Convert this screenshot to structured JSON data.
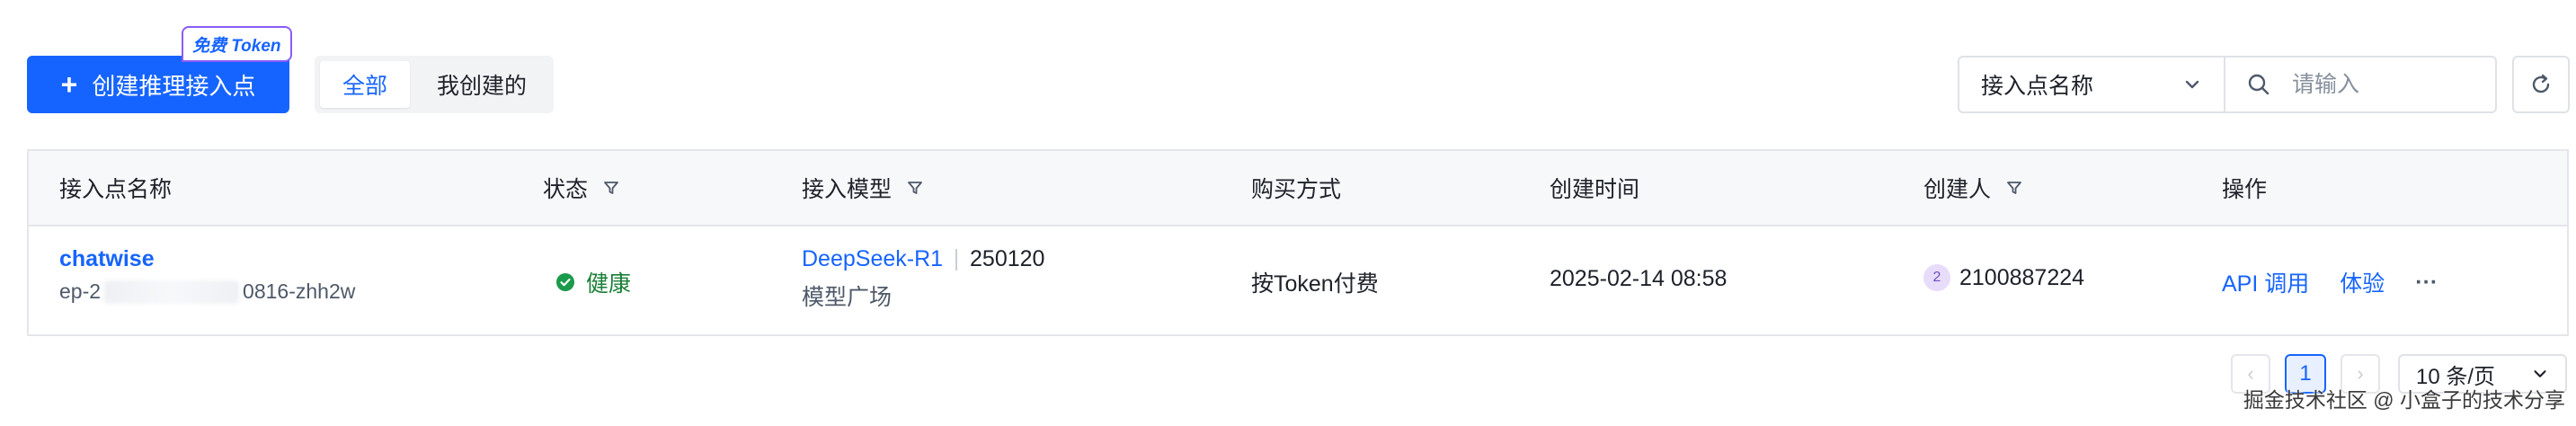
{
  "toolbar": {
    "create_label": "创建推理接入点",
    "free_badge": "免费 Token",
    "seg_all": "全部",
    "seg_mine": "我创建的",
    "filter_select": "接入点名称",
    "search_placeholder": "请输入"
  },
  "table": {
    "headers": {
      "name": "接入点名称",
      "status": "状态",
      "model": "接入模型",
      "purchase": "购买方式",
      "created_time": "创建时间",
      "creator": "创建人",
      "actions": "操作"
    },
    "rows": [
      {
        "name": "chatwise",
        "id_prefix": "ep-2",
        "id_suffix": "0816-zhh2w",
        "status": "健康",
        "model_name": "DeepSeek-R1",
        "model_version": "250120",
        "model_source": "模型广场",
        "purchase": "按Token付费",
        "created_time": "2025-02-14 08:58",
        "creator_badge": "2",
        "creator": "2100887224",
        "action_api": "API 调用",
        "action_try": "体验",
        "action_more": "···"
      }
    ]
  },
  "pagination": {
    "prev": "‹",
    "current": "1",
    "next": "›",
    "page_size": "10 条/页"
  },
  "watermark": "掘金技术社区 @ 小盒子的技术分享",
  "colors": {
    "primary": "#1664ff",
    "success": "#1a7f37",
    "border": "#e5e6eb"
  }
}
